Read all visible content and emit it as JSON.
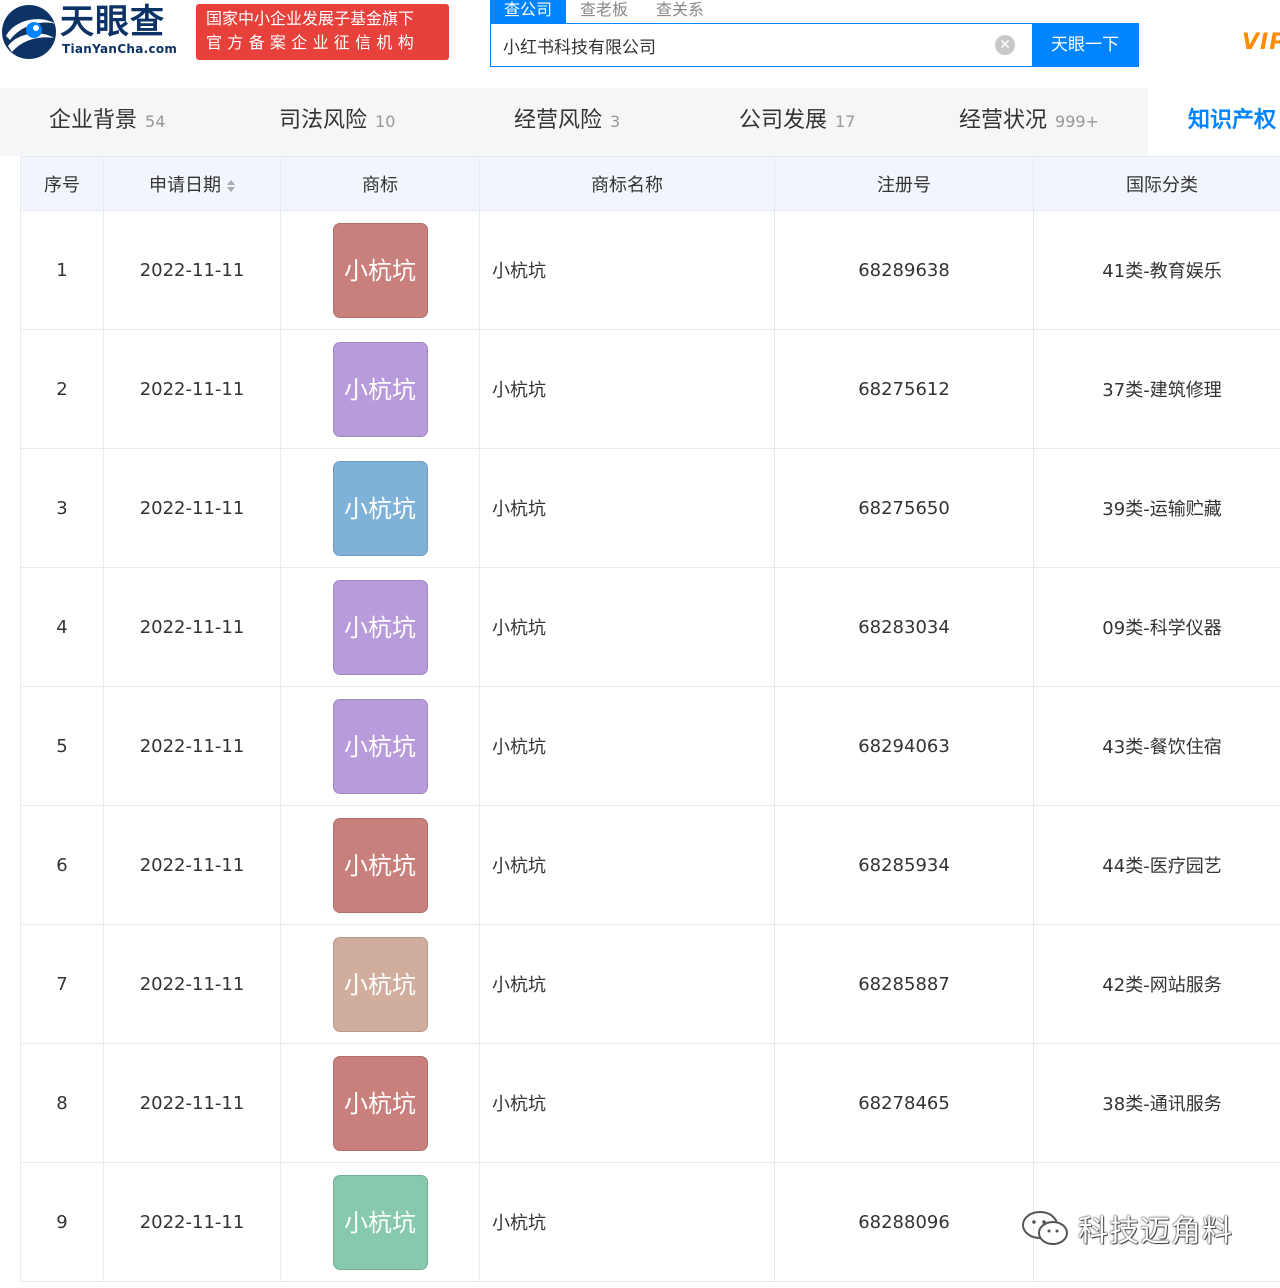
{
  "header": {
    "logo_cn": "天眼查",
    "logo_en": "TianYanCha.com",
    "badge_line1": "国家中小企业发展子基金旗下",
    "badge_line2": "官方备案企业征信机构",
    "search_tabs": [
      "查公司",
      "查老板",
      "查关系"
    ],
    "search_value": "小红书科技有限公司",
    "search_button": "天眼一下",
    "vip": "VIP"
  },
  "nav": [
    {
      "label": "企业背景",
      "count": "54"
    },
    {
      "label": "司法风险",
      "count": "10"
    },
    {
      "label": "经营风险",
      "count": "3"
    },
    {
      "label": "公司发展",
      "count": "17"
    },
    {
      "label": "经营状况",
      "count": "999+"
    },
    {
      "label": "知识产权",
      "count": ""
    }
  ],
  "table": {
    "headers": {
      "index": "序号",
      "date": "申请日期",
      "trademark": "商标",
      "name": "商标名称",
      "reg_no": "注册号",
      "class": "国际分类"
    },
    "rows": [
      {
        "index": "1",
        "date": "2022-11-11",
        "tm_text": "小杭坑",
        "tm_color": "#c9807d",
        "name": "小杭坑",
        "reg_no": "68289638",
        "class": "41类-教育娱乐"
      },
      {
        "index": "2",
        "date": "2022-11-11",
        "tm_text": "小杭坑",
        "tm_color": "#b89bdb",
        "name": "小杭坑",
        "reg_no": "68275612",
        "class": "37类-建筑修理"
      },
      {
        "index": "3",
        "date": "2022-11-11",
        "tm_text": "小杭坑",
        "tm_color": "#7fb2d8",
        "name": "小杭坑",
        "reg_no": "68275650",
        "class": "39类-运输贮藏"
      },
      {
        "index": "4",
        "date": "2022-11-11",
        "tm_text": "小杭坑",
        "tm_color": "#b89bdb",
        "name": "小杭坑",
        "reg_no": "68283034",
        "class": "09类-科学仪器"
      },
      {
        "index": "5",
        "date": "2022-11-11",
        "tm_text": "小杭坑",
        "tm_color": "#b89bdb",
        "name": "小杭坑",
        "reg_no": "68294063",
        "class": "43类-餐饮住宿"
      },
      {
        "index": "6",
        "date": "2022-11-11",
        "tm_text": "小杭坑",
        "tm_color": "#c9807d",
        "name": "小杭坑",
        "reg_no": "68285934",
        "class": "44类-医疗园艺"
      },
      {
        "index": "7",
        "date": "2022-11-11",
        "tm_text": "小杭坑",
        "tm_color": "#d1ad9e",
        "name": "小杭坑",
        "reg_no": "68285887",
        "class": "42类-网站服务"
      },
      {
        "index": "8",
        "date": "2022-11-11",
        "tm_text": "小杭坑",
        "tm_color": "#c9807d",
        "name": "小杭坑",
        "reg_no": "68278465",
        "class": "38类-通讯服务"
      },
      {
        "index": "9",
        "date": "2022-11-11",
        "tm_text": "小杭坑",
        "tm_color": "#86c9ac",
        "name": "小杭坑",
        "reg_no": "68288096",
        "class": ""
      }
    ]
  },
  "watermark": "科技迈角料",
  "colors": {
    "primary": "#0084ff",
    "badge": "#e8413c",
    "vip": "#ff8a00",
    "logo": "#0c3266"
  }
}
